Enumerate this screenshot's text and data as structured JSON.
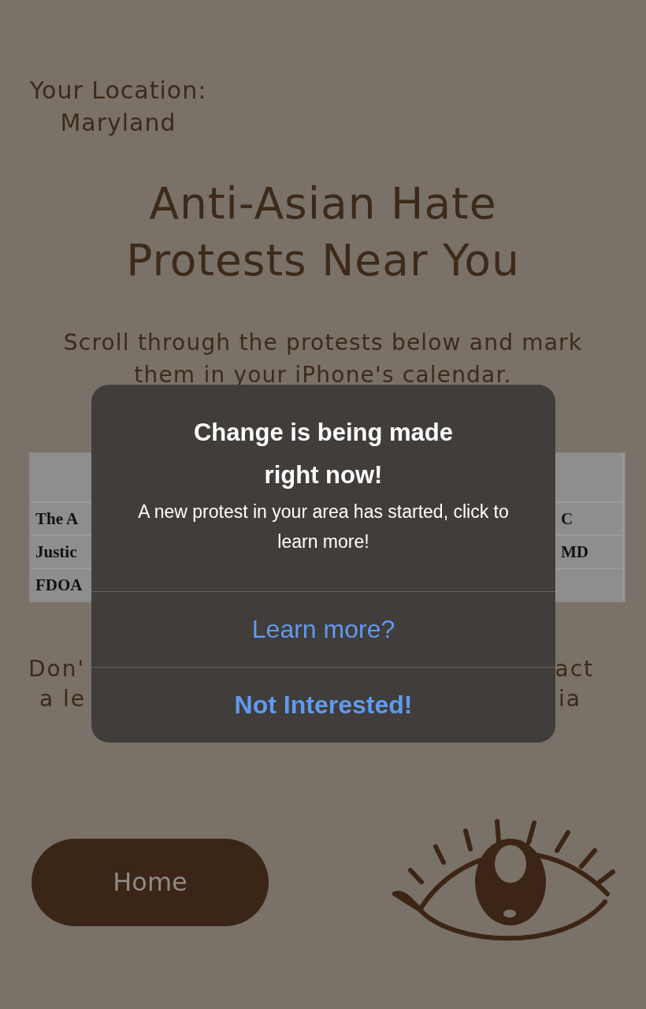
{
  "location": {
    "label": "Your Location:",
    "value": "Maryland"
  },
  "heading": "Anti-Asian Hate Protests Near You",
  "subtitle": "Scroll through the protests below and mark them in your iPhone's calendar.",
  "table": {
    "rows": [
      {
        "column_1": "The A",
        "column_3": "C"
      },
      {
        "column_1": "Justic",
        "column_3": "MD"
      },
      {
        "column_1": "FDOA"
      }
    ]
  },
  "footer_fragments": [
    {
      "left": "Don'",
      "right": "act"
    },
    {
      "left": "a le",
      "right": "ia"
    }
  ],
  "home_button": {
    "label": "Home"
  },
  "alert": {
    "title": "Change is being made right now!",
    "message": "A new protest in your area has started, click to learn more!",
    "buttons": [
      {
        "label": "Learn more?",
        "kind": "default"
      },
      {
        "label": "Not Interested!",
        "kind": "preferred"
      }
    ]
  }
}
